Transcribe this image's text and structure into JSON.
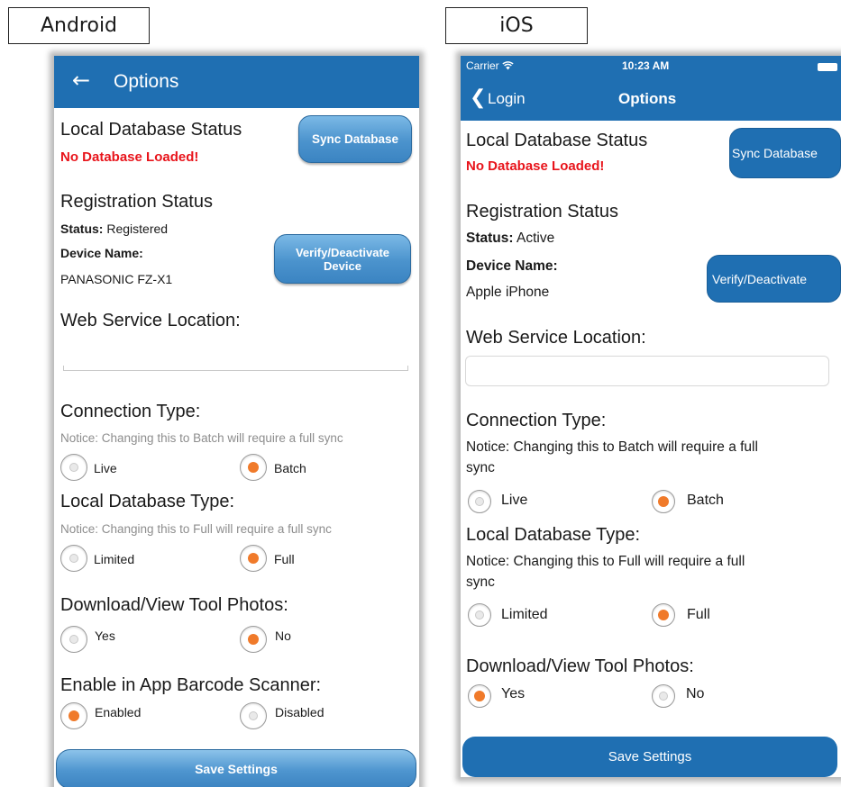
{
  "labels": {
    "android": "Android",
    "ios": "iOS"
  },
  "android": {
    "title": "Options",
    "back_icon": "arrow-left",
    "local_db_heading": "Local Database Status",
    "db_status": "No Database Loaded!",
    "sync_button": "Sync Database",
    "registration_heading": "Registration Status",
    "status_key": "Status:",
    "status_value": "Registered",
    "device_name_key": "Device Name:",
    "device_name_value": "PANASONIC FZ-X1",
    "verify_button_line1": "Verify/Deactivate",
    "verify_button_line2": "Device",
    "web_service_heading": "Web Service Location:",
    "web_service_value": "",
    "connection_heading": "Connection Type:",
    "connection_notice": "Notice: Changing this to Batch will require a full sync",
    "connection_options": [
      "Live",
      "Batch"
    ],
    "connection_selected": "Batch",
    "local_db_type_heading": "Local Database Type:",
    "local_db_type_notice": "Notice: Changing this to Full will require a full sync",
    "local_db_type_options": [
      "Limited",
      "Full"
    ],
    "local_db_type_selected": "Full",
    "photos_heading": "Download/View Tool Photos:",
    "photos_options": [
      "Yes",
      "No"
    ],
    "photos_selected": "No",
    "scanner_heading": "Enable in App Barcode Scanner:",
    "scanner_options": [
      "Enabled",
      "Disabled"
    ],
    "scanner_selected": "Enabled",
    "save_button": "Save Settings"
  },
  "ios": {
    "carrier": "Carrier",
    "time": "10:23 AM",
    "back_label": "Login",
    "title": "Options",
    "local_db_heading": "Local Database Status",
    "db_status": "No Database Loaded!",
    "sync_button": "Sync Database",
    "registration_heading": "Registration Status",
    "status_key": "Status:",
    "status_value": "Active",
    "device_name_key": "Device Name:",
    "device_name_value": "Apple iPhone",
    "verify_button": "Verify/Deactivate",
    "web_service_heading": "Web Service Location:",
    "web_service_value": "",
    "connection_heading": "Connection Type:",
    "connection_notice_line1": "Notice: Changing this to Batch will require a full",
    "connection_notice_line2": "sync",
    "connection_options": [
      "Live",
      "Batch"
    ],
    "connection_selected": "Batch",
    "local_db_type_heading": "Local Database Type:",
    "local_db_type_notice_line1": "Notice: Changing this to Full will require a full",
    "local_db_type_notice_line2": "sync",
    "local_db_type_options": [
      "Limited",
      "Full"
    ],
    "local_db_type_selected": "Full",
    "photos_heading": "Download/View Tool Photos:",
    "photos_options": [
      "Yes",
      "No"
    ],
    "photos_selected": "Yes",
    "save_button": "Save Settings"
  },
  "colors": {
    "header_blue": "#1f6fb2",
    "error_red": "#e8141b",
    "radio_selected": "#f07a2a",
    "notice_grey": "#8d8d8d"
  }
}
